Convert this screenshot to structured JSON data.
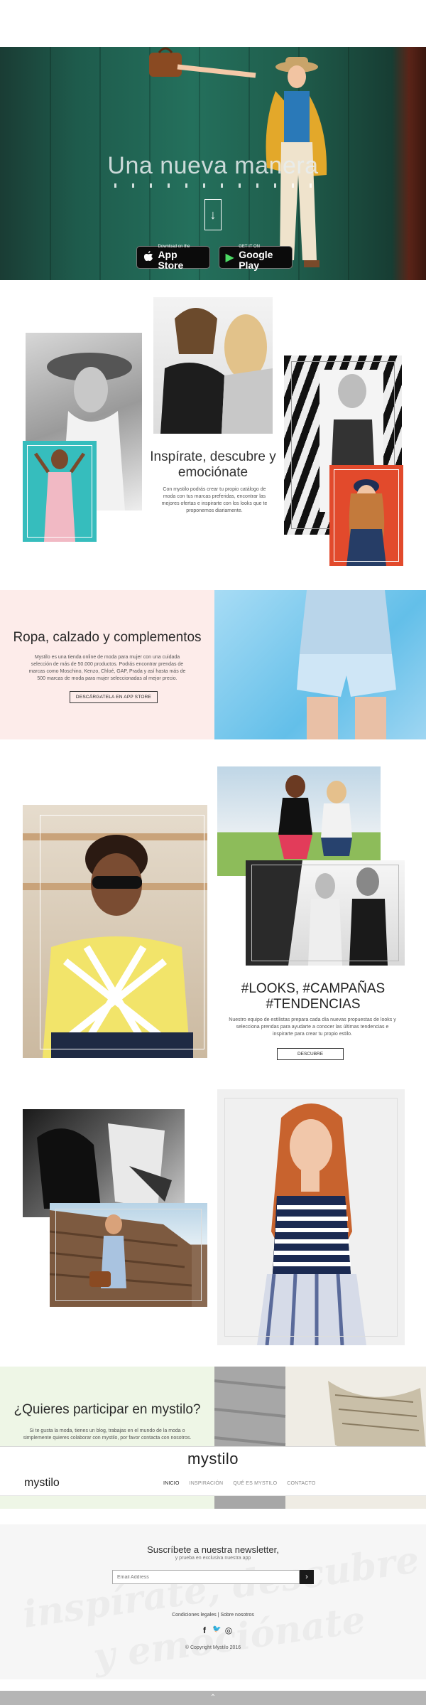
{
  "hero": {
    "title": "Una nueva manera",
    "arrow": "↓",
    "app_store": {
      "small": "Download on the",
      "big": "App Store",
      "icon": ""
    },
    "google_play": {
      "small": "GET IT ON",
      "big": "Google Play",
      "icon": "▶"
    }
  },
  "section_inspire": {
    "title": "Inspírate, descubre y emociónate",
    "text": "Con mystilo podrás crear tu propio catálogo de moda con tus marcas preferidas, encontrar las mejores ofertas e inspirarte con los looks que te proponemos diariamente."
  },
  "section_clothes": {
    "title": "Ropa, calzado y complementos",
    "text": "Mystilo es una tienda online de moda para mujer con una cuidada selección de más de 50.000 productos. Podrás encontrar prendas de marcas como Moschino, Kenzo, Chloé, GAP, Prada y así hasta más de 500 marcas de moda para mujer seleccionadas al mejor precio.",
    "button": "DESCÁRGATELA EN APP STORE"
  },
  "section_looks": {
    "title": "#LOOKS, #CAMPAÑAS #TENDENCIAS",
    "text": "Nuestro equipo de estilistas prepara cada día nuevas propuestas de looks y selecciona prendas para ayudarte a conocer las últimas tendencias e inspirarte para crear tu propio estilo.",
    "button": "DESCUBRE"
  },
  "section_participate": {
    "title": "¿Quieres participar en mystilo?",
    "text": "Si te gusta la moda, tienes un blog, trabajas en el mundo de la moda o simplemente quieres colaborar con mystilo, por favor contacta con nosotros."
  },
  "nav": {
    "brand": "mystilo",
    "links": [
      "INICIO",
      "INSPIRACIÓN",
      "QUÉ ES MYSTILO",
      "CONTACTO"
    ]
  },
  "newsletter": {
    "title": "Suscríbete a nuestra newsletter,",
    "subtitle": "y prueba en exclusiva nuestra app",
    "placeholder": "Email Address",
    "submit": "›"
  },
  "footer": {
    "links": "Condiciones legales  |  Sobre nosotros",
    "watermark_1": "inspírate, descubre",
    "watermark_2": "y emociónate",
    "social_icons": [
      "facebook-icon",
      "twitter-icon",
      "instagram-icon"
    ],
    "social_glyphs": [
      "f",
      "🐦",
      "◎"
    ],
    "copyright": "© Copyright Mystilo 2016"
  },
  "back_to_top": "⌃",
  "colors": {
    "hero_green": "#24705c",
    "pink_bg": "#fdecea",
    "green_bg": "#eef6e6",
    "accent_red": "#e24a2c"
  }
}
